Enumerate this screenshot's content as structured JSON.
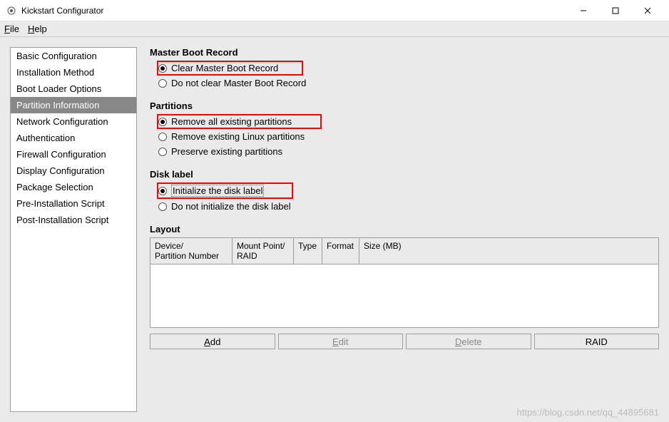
{
  "window": {
    "title": "Kickstart Configurator"
  },
  "menu": {
    "file": "File",
    "help": "Help"
  },
  "sidebar": {
    "items": [
      "Basic Configuration",
      "Installation Method",
      "Boot Loader Options",
      "Partition Information",
      "Network Configuration",
      "Authentication",
      "Firewall Configuration",
      "Display Configuration",
      "Package Selection",
      "Pre-Installation Script",
      "Post-Installation Script"
    ],
    "selected_index": 3
  },
  "mbr": {
    "title": "Master Boot Record",
    "clear": "Clear Master Boot Record",
    "noclear": "Do not clear Master Boot Record"
  },
  "partitions": {
    "title": "Partitions",
    "remove_all": "Remove all existing partitions",
    "remove_linux": "Remove existing Linux partitions",
    "preserve": "Preserve existing partitions"
  },
  "disklabel": {
    "title": "Disk label",
    "init": "Initialize the disk label",
    "noinit": "Do not initialize the disk label"
  },
  "layout": {
    "title": "Layout",
    "cols": {
      "device": "Device/\nPartition Number",
      "mount": "Mount Point/\nRAID",
      "type": "Type",
      "format": "Format",
      "size": "Size (MB)"
    }
  },
  "buttons": {
    "add": "Add",
    "edit": "Edit",
    "delete": "Delete",
    "raid": "RAID"
  },
  "watermark": "https://blog.csdn.net/qq_44895681"
}
